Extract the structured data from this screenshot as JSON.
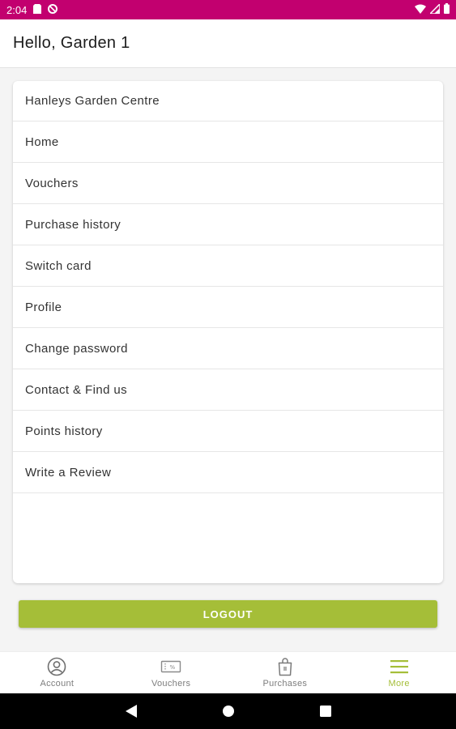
{
  "status_bar": {
    "time": "2:04",
    "background": "#c2006f",
    "icons": [
      "sim-card-icon",
      "data-saver-icon",
      "wifi-icon",
      "signal-icon",
      "battery-icon"
    ]
  },
  "header": {
    "title": "Hello, Garden 1"
  },
  "menu": {
    "items": [
      {
        "label": "Hanleys Garden Centre"
      },
      {
        "label": "Home"
      },
      {
        "label": "Vouchers"
      },
      {
        "label": "Purchase history"
      },
      {
        "label": "Switch card"
      },
      {
        "label": "Profile"
      },
      {
        "label": "Change password"
      },
      {
        "label": "Contact & Find us"
      },
      {
        "label": "Points history"
      },
      {
        "label": "Write a Review"
      }
    ]
  },
  "logout": {
    "label": "LOGOUT",
    "color": "#a5be38"
  },
  "bottom_nav": {
    "active_color": "#a5be38",
    "items": [
      {
        "label": "Account",
        "icon": "account-icon",
        "active": false
      },
      {
        "label": "Vouchers",
        "icon": "voucher-icon",
        "active": false
      },
      {
        "label": "Purchases",
        "icon": "shopping-bag-icon",
        "active": false
      },
      {
        "label": "More",
        "icon": "menu-icon",
        "active": true
      }
    ]
  },
  "system_nav": {
    "icons": [
      "back-icon",
      "home-icon",
      "recents-icon"
    ]
  }
}
